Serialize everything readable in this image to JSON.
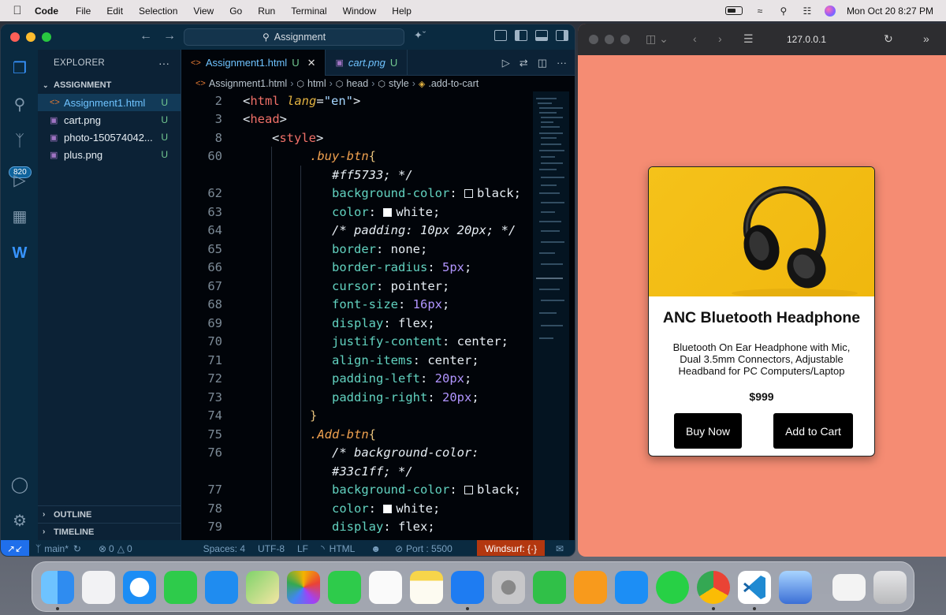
{
  "menubar": {
    "app": "Code",
    "items": [
      "File",
      "Edit",
      "Selection",
      "View",
      "Go",
      "Run",
      "Terminal",
      "Window",
      "Help"
    ],
    "datetime": "Mon Oct 20  8:27 PM"
  },
  "vscode": {
    "command_center": "Assignment",
    "activity_badge": "820",
    "explorer_title": "EXPLORER",
    "explorer_more": "···",
    "section_title": "ASSIGNMENT",
    "files": [
      {
        "icon": "<>",
        "name": "Assignment1.html",
        "status": "U"
      },
      {
        "icon": "▣",
        "name": "cart.png",
        "status": "U"
      },
      {
        "icon": "▣",
        "name": "photo-150574042...",
        "status": "U"
      },
      {
        "icon": "▣",
        "name": "plus.png",
        "status": "U"
      }
    ],
    "outline": "OUTLINE",
    "timeline": "TIMELINE",
    "tabs": [
      {
        "icon": "<>",
        "label": "Assignment1.html",
        "status": "U",
        "close": "✕"
      },
      {
        "icon": "▣",
        "label": "cart.png",
        "status": "U"
      }
    ],
    "breadcrumb": [
      "Assignment1.html",
      "html",
      "head",
      "style",
      ".add-to-cart"
    ],
    "status": {
      "branch": "main*",
      "errors": "0",
      "warnings": "0",
      "spaces": "Spaces: 4",
      "encoding": "UTF-8",
      "eol": "LF",
      "language": "HTML",
      "port": "Port : 5500",
      "windsurf": "Windsurf: {·}"
    }
  },
  "code_lines": [
    {
      "n": "2",
      "text": "<html lang=\"en\">"
    },
    {
      "n": "3",
      "text": "<head>"
    },
    {
      "n": "8",
      "text": "<style>"
    },
    {
      "n": "60",
      "text": ".buy-btn{"
    },
    {
      "n": "",
      "text": "#ff5733; */"
    },
    {
      "n": "62",
      "text": "background-color: black;"
    },
    {
      "n": "63",
      "text": "color: white;"
    },
    {
      "n": "64",
      "text": "/* padding: 10px 20px; */"
    },
    {
      "n": "65",
      "text": "border: none;"
    },
    {
      "n": "66",
      "text": "border-radius: 5px;"
    },
    {
      "n": "67",
      "text": "cursor: pointer;"
    },
    {
      "n": "68",
      "text": "font-size: 16px;"
    },
    {
      "n": "69",
      "text": "display: flex;"
    },
    {
      "n": "70",
      "text": "justify-content: center;"
    },
    {
      "n": "71",
      "text": "align-items: center;"
    },
    {
      "n": "72",
      "text": "padding-left: 20px;"
    },
    {
      "n": "73",
      "text": "padding-right: 20px;"
    },
    {
      "n": "74",
      "text": "}"
    },
    {
      "n": "75",
      "text": ".Add-btn{"
    },
    {
      "n": "76",
      "text": "/* background-color:"
    },
    {
      "n": "",
      "text": "#33c1ff; */"
    },
    {
      "n": "77",
      "text": "background-color: black;"
    },
    {
      "n": "78",
      "text": "color: white;"
    },
    {
      "n": "79",
      "text": "display: flex;"
    }
  ],
  "browser": {
    "url": "127.0.0.1",
    "product": {
      "title": "ANC Bluetooth Headphone",
      "description": "Bluetooth On Ear Headphone with Mic, Dual 3.5mm Connectors, Adjustable Headband for PC Computers/Laptop",
      "price": "$999",
      "buy_label": "Buy Now",
      "cart_label": "Add to Cart"
    }
  },
  "dock_apps": [
    "Finder",
    "Launchpad",
    "Safari",
    "Messages",
    "Mail",
    "Maps",
    "Photos",
    "FaceTime",
    "Reminders",
    "Notes",
    "Keynote",
    "System Settings",
    "Numbers",
    "Pages",
    "App Store",
    "WhatsApp",
    "Chrome",
    "VS Code",
    "Preview",
    "Downloads",
    "Trash"
  ]
}
